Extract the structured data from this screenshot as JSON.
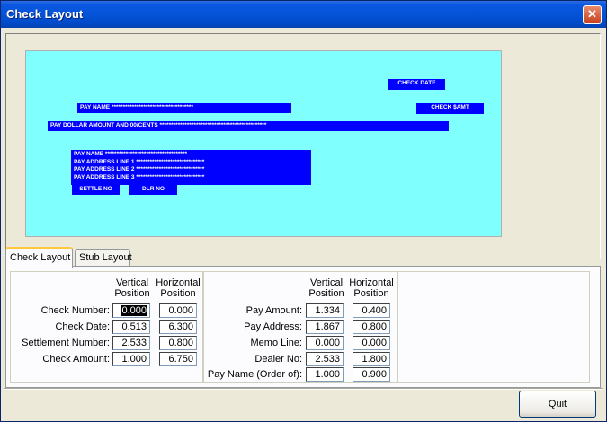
{
  "window": {
    "title": "Check Layout",
    "close_glyph": "✕"
  },
  "check_preview": {
    "background": "#80ffff",
    "field_color": "#0000ff",
    "check_date": "CHECK DATE",
    "check_amt": "CHECK $AMT",
    "pay_name": "PAY NAME ************************************",
    "pay_dollar": "PAY DOLLAR AMOUNT AND 00/CENTS ***********************************************",
    "address_block": {
      "lines": [
        "PAY NAME ************************************",
        "PAY ADDRESS LINE 1 ******************************",
        "PAY ADDRESS LINE 2 ******************************",
        "PAY ADDRESS LINE 3 ******************************"
      ]
    },
    "settle_no": "SETTLE NO",
    "dlr_no": "DLR NO"
  },
  "tabs": [
    {
      "label": "Check Layout",
      "active": true
    },
    {
      "label": "Stub Layout",
      "active": false
    }
  ],
  "group1": {
    "col_vertical": "Vertical Position",
    "col_horizontal": "Horizontal Position",
    "rows": [
      {
        "label": "Check Number:",
        "vertical": "0.000",
        "horizontal": "0.000"
      },
      {
        "label": "Check Date:",
        "vertical": "0.513",
        "horizontal": "6.300"
      },
      {
        "label": "Settlement Number:",
        "vertical": "2.533",
        "horizontal": "0.800"
      },
      {
        "label": "Check Amount:",
        "vertical": "1.000",
        "horizontal": "6.750"
      }
    ]
  },
  "group2": {
    "col_vertical": "Vertical Position",
    "col_horizontal": "Horizontal Position",
    "rows": [
      {
        "label": "Pay Amount:",
        "vertical": "1.334",
        "horizontal": "0.400"
      },
      {
        "label": "Pay Address:",
        "vertical": "1.867",
        "horizontal": "0.800"
      },
      {
        "label": "Memo Line:",
        "vertical": "0.000",
        "horizontal": "0.000"
      },
      {
        "label": "Dealer No:",
        "vertical": "2.533",
        "horizontal": "1.800"
      },
      {
        "label": "Pay Name (Order of):",
        "vertical": "1.000",
        "horizontal": "0.900"
      }
    ]
  },
  "buttons": {
    "quit": "Quit"
  }
}
